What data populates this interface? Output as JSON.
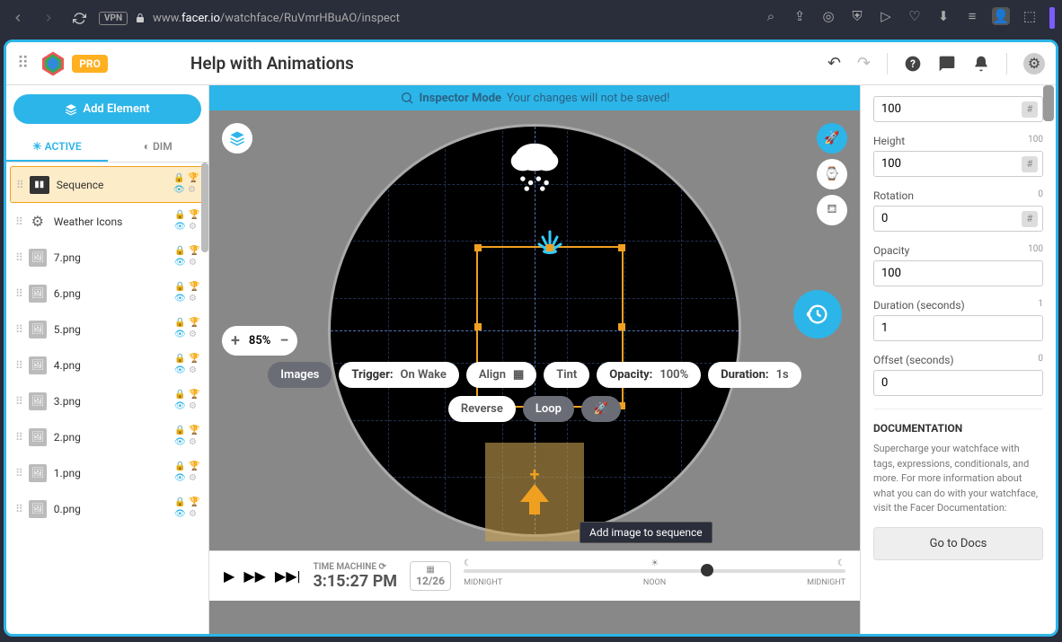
{
  "browser": {
    "url_prefix": "www.",
    "url_domain": "facer.io",
    "url_path": "/watchface/RuVmrHBuAO/inspect",
    "vpn": "VPN"
  },
  "header": {
    "pro_badge": "PRO",
    "title": "Help with Animations"
  },
  "left_panel": {
    "add_element": "Add Element",
    "tabs": {
      "active": "ACTIVE",
      "dim": "DIM"
    },
    "layers": [
      {
        "name": "Sequence",
        "type": "seq",
        "selected": true
      },
      {
        "name": "Weather Icons",
        "type": "gear",
        "selected": false
      },
      {
        "name": "7.png",
        "type": "img",
        "selected": false
      },
      {
        "name": "6.png",
        "type": "img",
        "selected": false
      },
      {
        "name": "5.png",
        "type": "img",
        "selected": false
      },
      {
        "name": "4.png",
        "type": "img",
        "selected": false
      },
      {
        "name": "3.png",
        "type": "img",
        "selected": false
      },
      {
        "name": "2.png",
        "type": "img",
        "selected": false
      },
      {
        "name": "1.png",
        "type": "img",
        "selected": false
      },
      {
        "name": "0.png",
        "type": "img",
        "selected": false
      }
    ]
  },
  "canvas": {
    "banner_strong": "Inspector Mode",
    "banner_text": "Your changes will not be saved!",
    "zoom": "85%",
    "pills": {
      "images": "Images",
      "trigger_label": "Trigger:",
      "trigger_value": "On Wake",
      "align": "Align",
      "tint": "Tint",
      "opacity_label": "Opacity:",
      "opacity_value": "100%",
      "duration_label": "Duration:",
      "duration_value": "1s",
      "reverse": "Reverse",
      "loop": "Loop"
    },
    "tooltip": "Add image to sequence"
  },
  "timeline": {
    "time_machine": "TIME MACHINE",
    "time": "3:15:27 PM",
    "date": "12/26",
    "midnight": "MIDNIGHT",
    "noon": "NOON"
  },
  "right_panel": {
    "height_label": "Height",
    "height_hint": "100",
    "height_value": "100",
    "rotation_label": "Rotation",
    "rotation_hint": "0",
    "rotation_value": "0",
    "opacity_label": "Opacity",
    "opacity_hint": "100",
    "opacity_value": "100",
    "duration_label": "Duration (seconds)",
    "duration_hint": "1",
    "duration_value": "1",
    "offset_label": "Offset (seconds)",
    "offset_hint": "0",
    "offset_value": "0",
    "top_value": "100",
    "doc_title": "DOCUMENTATION",
    "doc_text": "Supercharge your watchface with tags, expressions, conditionals, and more. For more information about what you can do with your watchface, visit the Facer Documentation:",
    "doc_btn": "Go to Docs"
  }
}
